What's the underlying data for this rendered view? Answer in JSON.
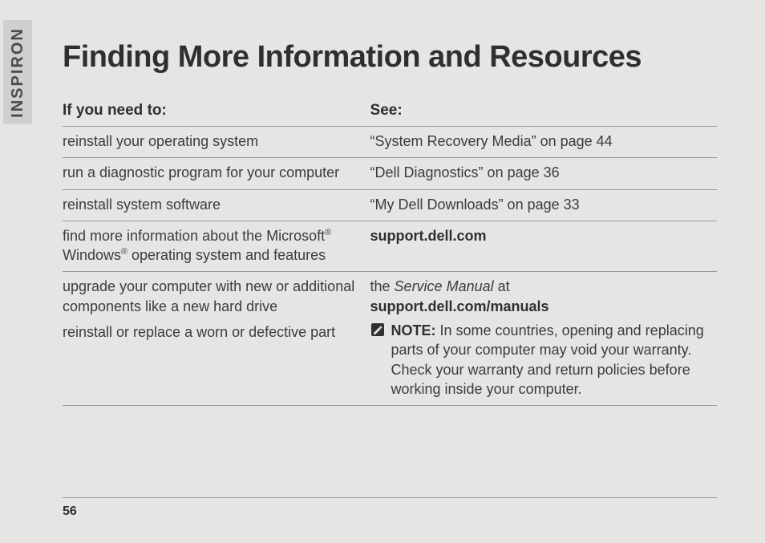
{
  "side_label": "INSPIRON",
  "title": "Finding More Information and Resources",
  "headers": {
    "left": "If you need to:",
    "right": "See:"
  },
  "rows": {
    "r1": {
      "need": "reinstall your operating system",
      "see": "“System Recovery Media” on page 44"
    },
    "r2": {
      "need": "run a diagnostic program for your computer",
      "see": "“Dell Diagnostics” on page 36"
    },
    "r3": {
      "need": "reinstall system software",
      "see": "“My Dell Downloads” on page 33"
    },
    "r4": {
      "need_pre": "find more information about the Microsoft",
      "need_mid": " Windows",
      "need_post": " operating system and features",
      "see_bold": "support.dell.com"
    },
    "r5": {
      "need_line1": "upgrade your computer with new or additional components like a new hard drive",
      "need_line2": "reinstall or replace a worn or defective part",
      "see_pre": "the ",
      "see_em": "Service Manual",
      "see_post": " at",
      "see_link": "support.dell.com/manuals",
      "note_label": "NOTE:",
      "note_text": " In some countries, opening and replacing parts of your computer may void your warranty. Check your warranty and return policies before working inside your computer."
    }
  },
  "reg_mark": "®",
  "page_number": "56"
}
